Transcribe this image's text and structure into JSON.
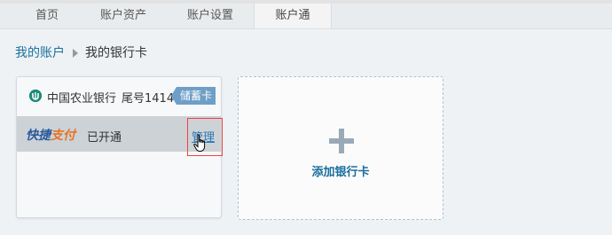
{
  "nav": {
    "tabs": [
      {
        "label": "首页"
      },
      {
        "label": "账户资产"
      },
      {
        "label": "账户设置"
      },
      {
        "label": "账户通"
      }
    ],
    "active_tab": "账户通"
  },
  "breadcrumb": {
    "parent": "我的账户",
    "current": "我的银行卡"
  },
  "bank_card": {
    "bank_name": "中国农业银行",
    "tail_number": "尾号1414",
    "card_type": "储蓄卡",
    "quickpay_logo_part1": "快捷",
    "quickpay_logo_part2": "支付",
    "status": "已开通",
    "manage_label": "管理"
  },
  "add_card": {
    "label": "添加银行卡"
  },
  "colors": {
    "link": "#1b6f9c",
    "card_type_badge": "#6e9fc7",
    "highlight_box": "#ee4444"
  }
}
